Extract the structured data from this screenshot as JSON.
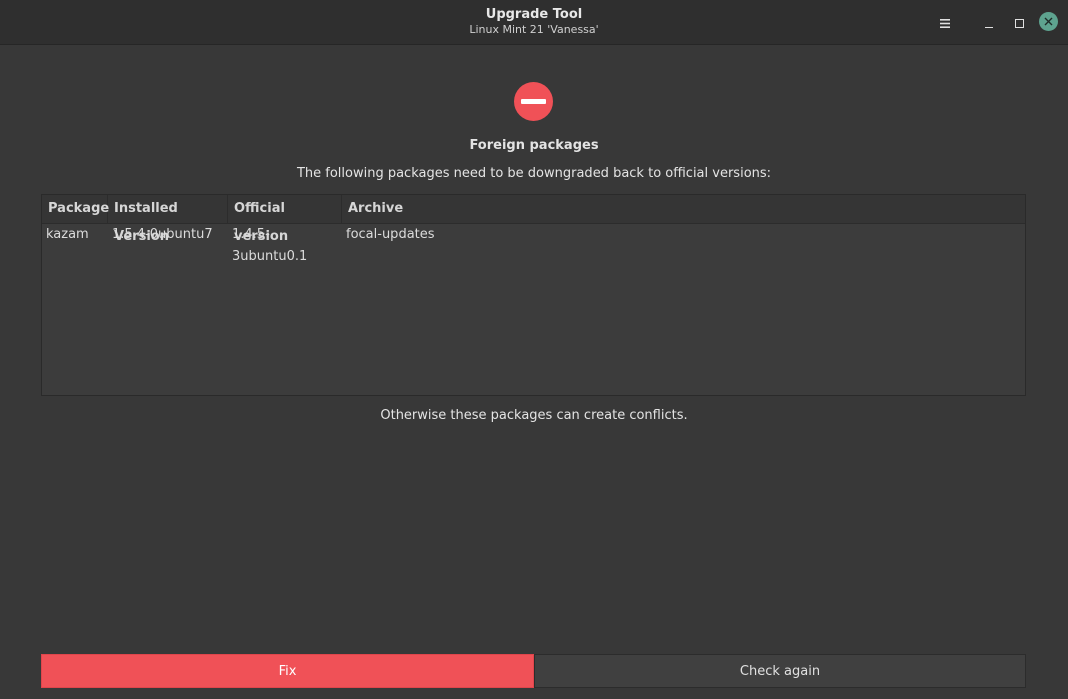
{
  "window": {
    "title": "Upgrade Tool",
    "subtitle": "Linux Mint 21 'Vanessa'",
    "menu_icon": "hamburger-menu-icon",
    "minimize_icon": "minimize-icon",
    "maximize_icon": "maximize-icon",
    "close_icon": "close-icon"
  },
  "main": {
    "status_icon": "error-stop-icon",
    "heading": "Foreign packages",
    "description": "The following packages need to be downgraded back to official versions:",
    "note": "Otherwise these packages can create conflicts."
  },
  "table": {
    "columns": [
      "Package",
      "Installed Version",
      "Official version",
      "Archive"
    ],
    "rows": [
      [
        "kazam",
        "1.5.4-0ubuntu7",
        "1.4.5-3ubuntu0.1",
        "focal-updates"
      ]
    ]
  },
  "buttons": {
    "fix": "Fix",
    "check_again": "Check again"
  },
  "colors": {
    "accent_red": "#f05157",
    "close_button": "#5ea38f",
    "background": "#383838"
  }
}
